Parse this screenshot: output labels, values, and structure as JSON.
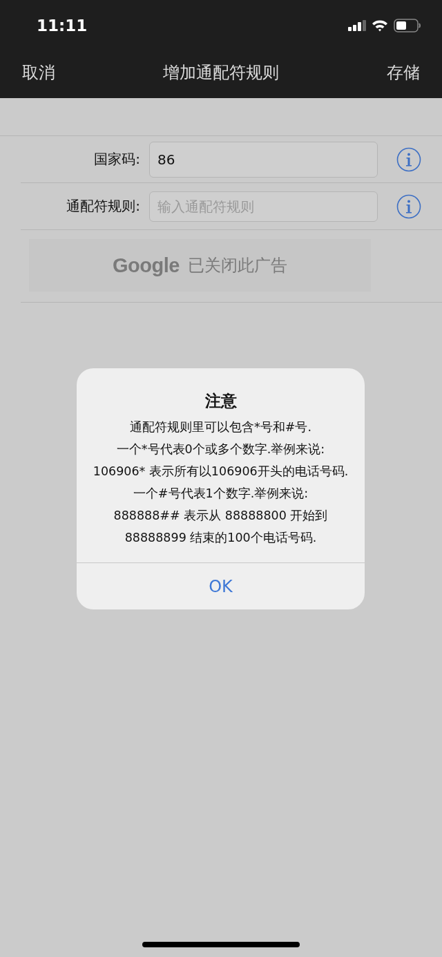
{
  "status_bar": {
    "time": "11:11"
  },
  "nav_bar": {
    "cancel": "取消",
    "title": "增加通配符规则",
    "save": "存储"
  },
  "form": {
    "fields": [
      {
        "label": "国家码:",
        "value": "86"
      },
      {
        "label": "通配符规则:",
        "placeholder": "输入通配符规则"
      }
    ]
  },
  "ad": {
    "logo": "Google",
    "text": "已关闭此广告"
  },
  "alert": {
    "title": "注意",
    "message": "通配符规则里可以包含*号和#号.\n一个*号代表0个或多个数字.举例来说:\n106906* 表示所有以106906开头的电话号码.\n一个#号代表1个数字.举例来说:\n888888## 表示从 88888800 开始到 88888899 结束的100个电话号码.",
    "button": "OK"
  }
}
